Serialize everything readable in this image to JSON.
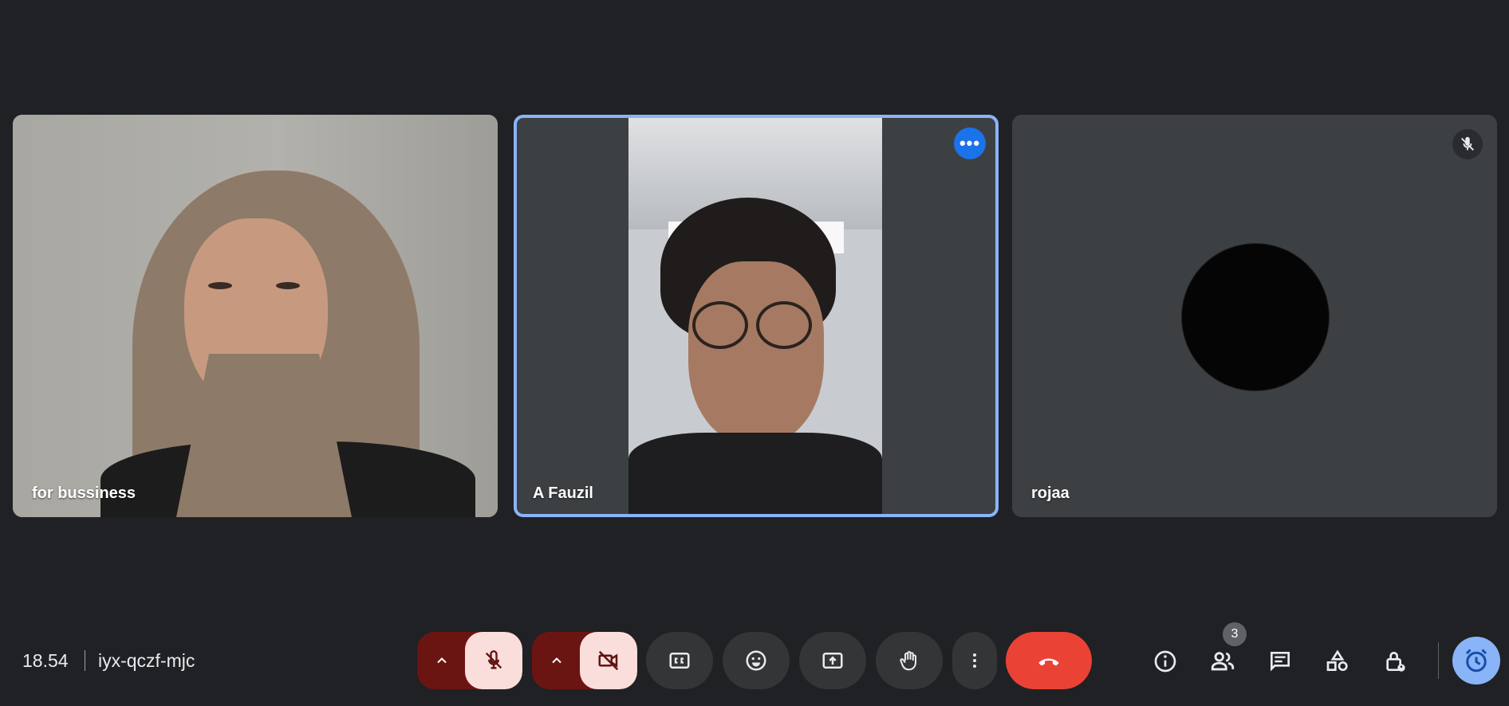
{
  "participants": [
    {
      "name": "for bussiness"
    },
    {
      "name": "A Fauzil"
    },
    {
      "name": "rojaa"
    }
  ],
  "meeting": {
    "time": "18.54",
    "code": "iyx-qczf-mjc"
  },
  "people_count": "3",
  "colors": {
    "end_call": "#ea4335",
    "active_speaker_border": "#8ab4f8",
    "muted_control": "#f9dedc"
  },
  "icons": [
    "mic-off-icon",
    "videocam-off-icon",
    "captions-icon",
    "emoji-icon",
    "present-icon",
    "raise-hand-icon",
    "more-vert-icon",
    "call-end-icon",
    "info-icon",
    "people-icon",
    "chat-icon",
    "activities-icon",
    "host-controls-icon",
    "timer-icon"
  ]
}
